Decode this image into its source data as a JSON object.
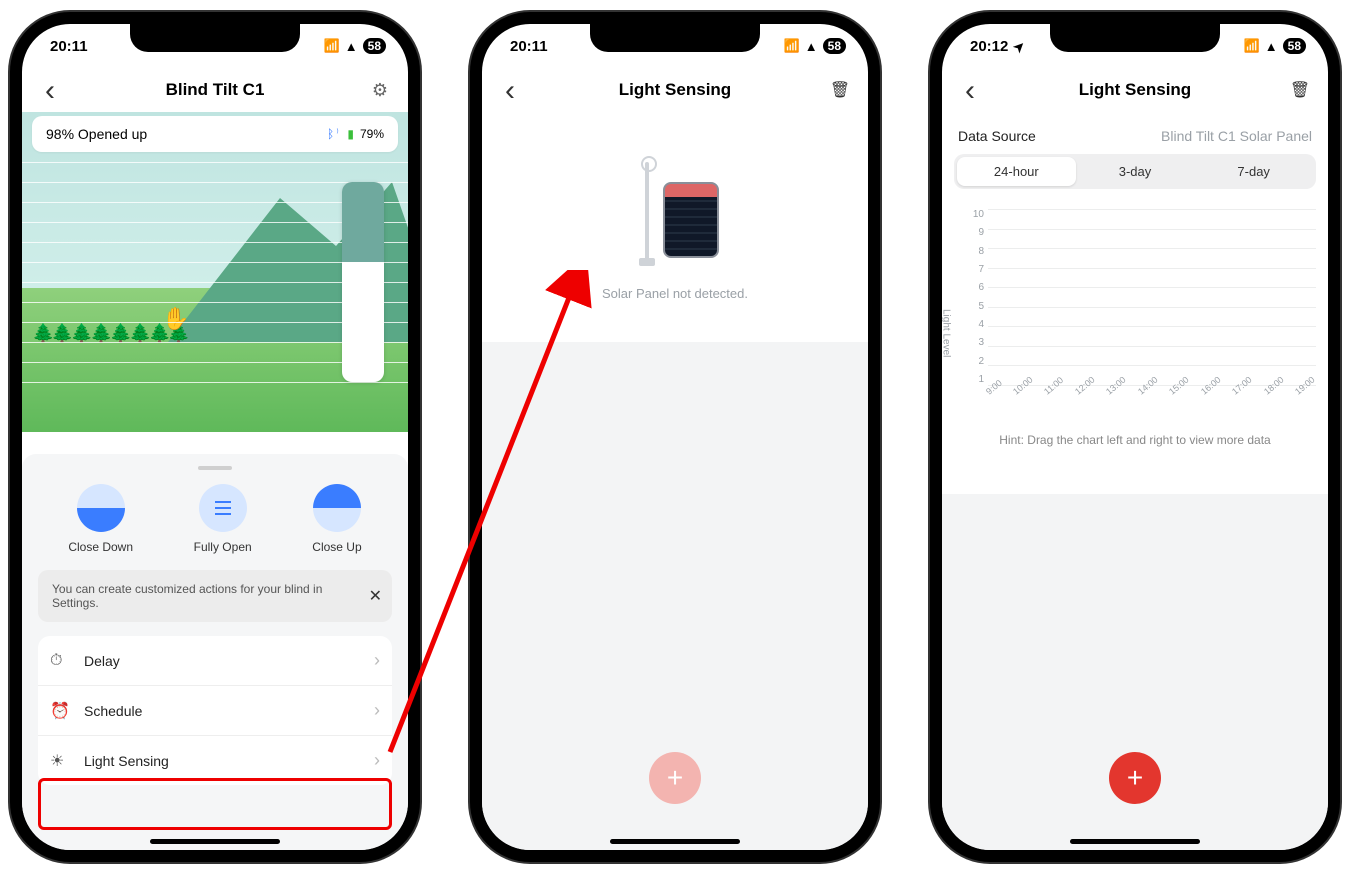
{
  "statusbar": {
    "time_a": "20:11",
    "time_b": "20:11",
    "time_c": "20:12",
    "battery": "58"
  },
  "phone1": {
    "title": "Blind Tilt C1",
    "open_status": "98% Opened up",
    "battery_pct": "79%",
    "actions": {
      "close_down": "Close Down",
      "fully_open": "Fully Open",
      "close_up": "Close Up"
    },
    "tip": "You can create customized actions for your blind in Settings.",
    "menu": {
      "delay": "Delay",
      "schedule": "Schedule",
      "light_sensing": "Light Sensing"
    }
  },
  "phone2": {
    "title": "Light Sensing",
    "msg": "Solar Panel not detected."
  },
  "phone3": {
    "title": "Light Sensing",
    "data_source_label": "Data Source",
    "data_source_value": "Blind Tilt C1 Solar Panel",
    "seg": {
      "h24": "24-hour",
      "d3": "3-day",
      "d7": "7-day"
    },
    "hint": "Hint: Drag the chart left and right to view more data"
  },
  "chart_data": {
    "type": "line",
    "title": "",
    "xlabel": "",
    "ylabel": "Light Level",
    "ylim": [
      1,
      10
    ],
    "y_ticks": [
      10,
      9,
      8,
      7,
      6,
      5,
      4,
      3,
      2,
      1
    ],
    "x_ticks": [
      "9:00",
      "10:00",
      "11:00",
      "12:00",
      "13:00",
      "14:00",
      "15:00",
      "16:00",
      "17:00",
      "18:00",
      "19:00"
    ],
    "series": [
      {
        "name": "Light Level",
        "x": [],
        "values": []
      }
    ]
  }
}
